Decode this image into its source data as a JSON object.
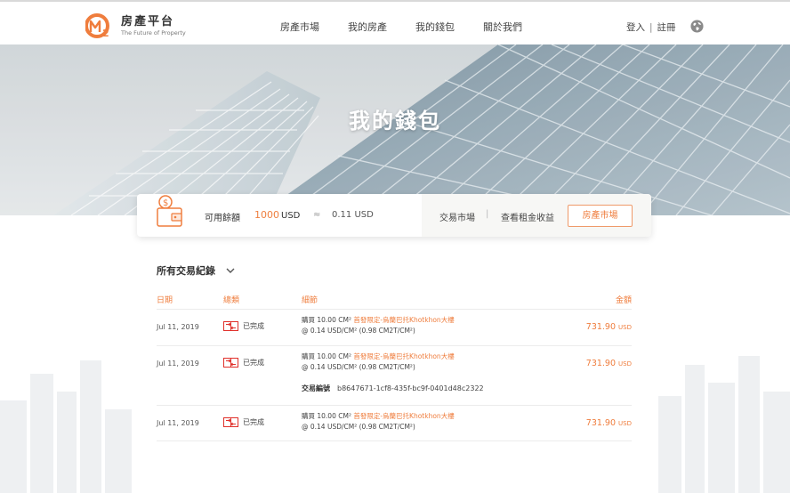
{
  "header": {
    "logo_title": "房產平台",
    "logo_subtitle": "The Future of Property",
    "nav": [
      "房產市場",
      "我的房產",
      "我的錢包",
      "關於我們"
    ],
    "login": "登入",
    "auth_sep": "|",
    "register": "註冊"
  },
  "hero": {
    "title": "我的錢包"
  },
  "wallet": {
    "available_label": "可用餘額",
    "amount": "1000",
    "amount_unit": "USD",
    "approx": "≈",
    "converted": "0.11 USD",
    "link_market": "交易市場",
    "sep": "|",
    "link_rent": "查看租金收益",
    "button": "房產市場"
  },
  "transactions": {
    "title": "所有交易紀錄",
    "headers": {
      "date": "日期",
      "status": "總類",
      "detail": "細節",
      "amount": "金額"
    },
    "rows": [
      {
        "date": "Jul 11, 2019",
        "status": "已完成",
        "detail_prefix": "購買 10.00 CM² ",
        "detail_highlight": "首發限定-烏蘭巴托Khotkhon大樓",
        "detail_line2": "@ 0.14 USD/CM² (0.98 CM2T/CM²)",
        "amount": "731.90",
        "currency": "USD"
      },
      {
        "date": "Jul 11, 2019",
        "status": "已完成",
        "detail_prefix": "購買 10.00 CM² ",
        "detail_highlight": "首發限定-烏蘭巴托Khotkhon大樓",
        "detail_line2": "@ 0.14 USD/CM² (0.98 CM2T/CM²)",
        "amount": "731.90",
        "currency": "USD",
        "txid_label": "交易編號",
        "txid": "b8647671-1cf8-435f-bc9f-0401d48c2322"
      },
      {
        "date": "Jul 11, 2019",
        "status": "已完成",
        "detail_prefix": "購買 10.00 CM² ",
        "detail_highlight": "首發限定-烏蘭巴托Khotkhon大樓",
        "detail_line2": "@ 0.14 USD/CM² (0.98 CM2T/CM²)",
        "amount": "731.90",
        "currency": "USD"
      }
    ]
  },
  "colors": {
    "accent": "#ef7d3d",
    "text": "#333333",
    "muted": "#999999"
  },
  "icons": [
    "logo-icon",
    "globe-icon",
    "wallet-icon",
    "chevron-down-icon",
    "transfer-icon"
  ]
}
